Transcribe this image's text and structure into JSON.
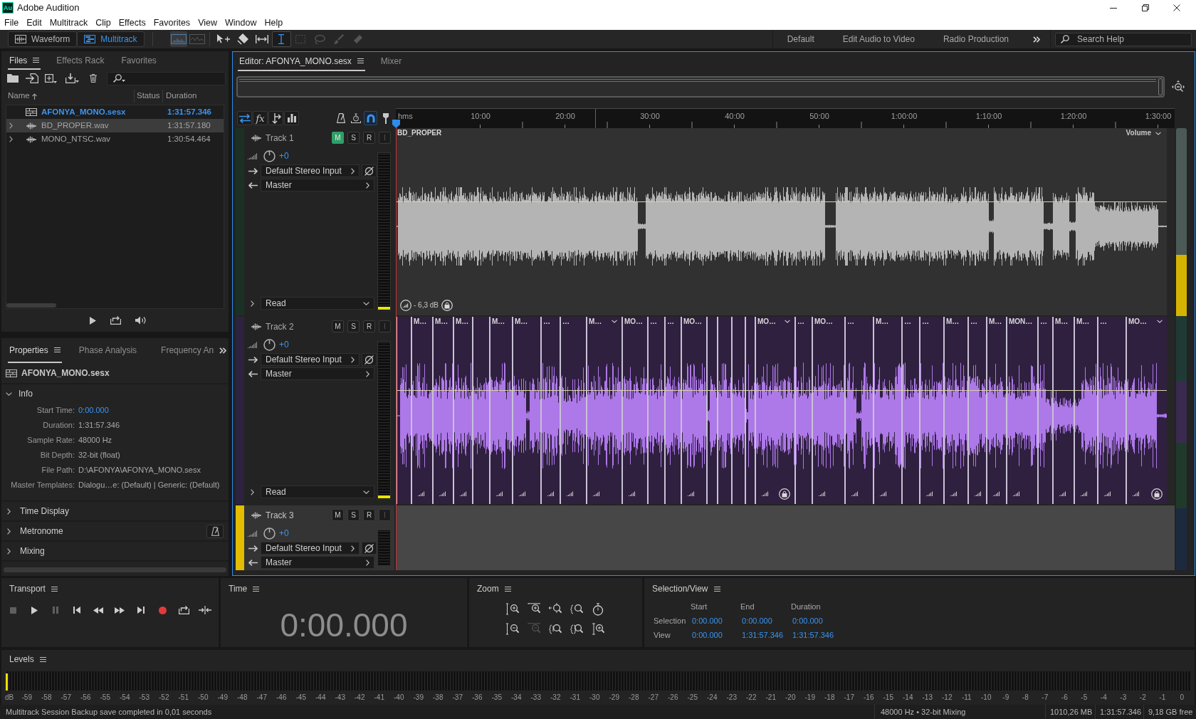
{
  "window": {
    "logo": "Au",
    "title": "Adobe Audition"
  },
  "menu": [
    "File",
    "Edit",
    "Multitrack",
    "Clip",
    "Effects",
    "Favorites",
    "View",
    "Window",
    "Help"
  ],
  "toolbar": {
    "views": [
      {
        "label": "Waveform",
        "selected": false
      },
      {
        "label": "Multitrack",
        "selected": true
      }
    ],
    "tools": [
      {
        "selected": true,
        "disabled": true
      },
      {
        "selected": false,
        "disabled": true
      },
      {
        "selected": false,
        "disabled": false
      },
      {
        "selected": false,
        "disabled": false
      },
      {
        "selected": false,
        "disabled": false
      },
      {
        "selected": true,
        "disabled": false
      },
      {
        "selected": false,
        "disabled": true
      },
      {
        "selected": false,
        "disabled": true
      },
      {
        "selected": false,
        "disabled": true
      },
      {
        "selected": false,
        "disabled": true
      }
    ],
    "workspaces": [
      "Default",
      "Edit Audio to Video",
      "Radio Production"
    ],
    "search": {
      "placeholder": "Search Help"
    }
  },
  "files_panel": {
    "tabs": [
      {
        "label": "Files",
        "selected": true
      },
      {
        "label": "Effects Rack",
        "selected": false
      },
      {
        "label": "Favorites",
        "selected": false
      }
    ],
    "columns": [
      "Name",
      "Status",
      "Duration"
    ],
    "rows": [
      {
        "kind": "session",
        "name": "AFONYA_MONO.sesx",
        "duration": "1:31:57.346",
        "open": true,
        "selected": false
      },
      {
        "kind": "audio",
        "name": "BD_PROPER.wav",
        "duration": "1:31:57.180",
        "open": false,
        "selected": true,
        "expanded": false
      },
      {
        "kind": "audio",
        "name": "MONO_NTSC.wav",
        "duration": "1:30:54.464",
        "open": false,
        "selected": false,
        "expanded": false
      }
    ]
  },
  "properties_panel": {
    "tabs": [
      {
        "label": "Properties",
        "selected": true
      },
      {
        "label": "Phase Analysis",
        "selected": false
      },
      {
        "label": "Frequency An",
        "selected": false
      }
    ],
    "file_name": "AFONYA_MONO.sesx",
    "sections": [
      {
        "title": "Info",
        "kind": "plain",
        "expanded": true,
        "rows": [
          {
            "label": "Start Time:",
            "value": "0:00.000",
            "editable": true
          },
          {
            "label": "Duration:",
            "value": "1:31:57.346",
            "editable": false
          },
          {
            "label": "Sample Rate:",
            "value": "48000 Hz",
            "editable": false
          },
          {
            "label": "Bit Depth:",
            "value": "32-bit (float)",
            "editable": false
          },
          {
            "label": "File Path:",
            "value": "D:\\AFONYA\\AFONYA_MONO.sesx",
            "editable": false
          },
          {
            "label": "Master Templates:",
            "value": "Dialogu…e: (Default) | Generic: (Default)",
            "editable": false
          }
        ]
      },
      {
        "title": "Time Display",
        "kind": "plain",
        "expanded": false
      },
      {
        "title": "Metronome",
        "kind": "button",
        "expanded": false
      },
      {
        "title": "Mixing",
        "kind": "plain",
        "expanded": false
      }
    ]
  },
  "editor": {
    "tabs": [
      {
        "label": "Editor: AFONYA_MONO.sesx",
        "selected": true
      },
      {
        "label": "Mixer",
        "selected": false
      }
    ],
    "view_buttons": [
      {
        "selected": true
      },
      {
        "label": "fx",
        "selected": false
      },
      {
        "selected": false
      },
      {
        "selected": false
      }
    ],
    "snap_buttons": [
      {
        "selected": false
      },
      {
        "selected": false
      },
      {
        "selected": true
      },
      {
        "selected": false
      }
    ],
    "ruler": {
      "unit": "hms",
      "labels": [
        "10:00",
        "20:00",
        "30:00",
        "40:00",
        "50:00",
        "1:00:00",
        "1:10:00",
        "1:20:00",
        "1:30:00"
      ]
    },
    "tracks": [
      {
        "name": "Track 1",
        "color": "#1c3126",
        "selected": false,
        "buttons": [
          {
            "label": "M",
            "on": true,
            "disabled": false
          },
          {
            "label": "S",
            "on": false,
            "disabled": false
          },
          {
            "label": "R",
            "on": false,
            "disabled": false
          },
          {
            "label": "I",
            "on": false,
            "disabled": true
          }
        ],
        "volume": "+0",
        "input": "Default Stereo Input",
        "output": "Master",
        "automation": "Read",
        "meter": {
          "level": 0.02
        },
        "clips": [
          {
            "label": "BD_PROPER",
            "color": "#b4b4b4",
            "envelope": "Volume",
            "gain": "- 6,3 dB",
            "locked": true
          }
        ]
      },
      {
        "name": "Track 2",
        "color": "#2d2340",
        "selected": false,
        "buttons": [
          {
            "label": "M",
            "on": false,
            "disabled": false
          },
          {
            "label": "S",
            "on": false,
            "disabled": false
          },
          {
            "label": "R",
            "on": false,
            "disabled": false
          },
          {
            "label": "I",
            "on": false,
            "disabled": true
          }
        ],
        "volume": "+0",
        "input": "Default Stereo Input",
        "output": "Master",
        "automation": "Read",
        "meter": {
          "level": 0.02
        },
        "clips": [
          {
            "color": "#ad78e8",
            "locked": false
          },
          {
            "label": "M…",
            "color": "#ad78e8",
            "locked": false
          },
          {
            "label": "M…",
            "color": "#ad78e8",
            "locked": false
          },
          {
            "label": "M…",
            "color": "#ad78e8",
            "locked": false
          },
          {
            "color": "#ad78e8",
            "locked": false
          },
          {
            "label": "M…",
            "color": "#ad78e8",
            "locked": false
          },
          {
            "label": "M…",
            "color": "#ad78e8",
            "locked": false
          },
          {
            "label": "…",
            "color": "#ad78e8",
            "locked": false
          },
          {
            "label": "…",
            "color": "#ad78e8",
            "locked": false
          },
          {
            "label": "M…",
            "color": "#ad78e8",
            "locked": false
          },
          {
            "label": "MO…",
            "color": "#ad78e8",
            "locked": false
          },
          {
            "label": "…",
            "color": "#ad78e8",
            "locked": false
          },
          {
            "label": "…",
            "color": "#ad78e8",
            "locked": false
          },
          {
            "label": "MO…",
            "color": "#ad78e8",
            "locked": false
          },
          {
            "color": "#ad78e8",
            "locked": false
          },
          {
            "color": "#ad78e8",
            "locked": false
          },
          {
            "color": "#ad78e8",
            "locked": false
          },
          {
            "color": "#ad78e8",
            "locked": false
          },
          {
            "label": "MO…",
            "color": "#ad78e8",
            "locked": true
          },
          {
            "label": "…",
            "color": "#ad78e8",
            "locked": false
          },
          {
            "label": "MO…",
            "color": "#ad78e8",
            "locked": false
          },
          {
            "label": "…",
            "color": "#ad78e8",
            "locked": false
          },
          {
            "label": "M…",
            "color": "#ad78e8",
            "locked": false
          },
          {
            "label": "…",
            "color": "#ad78e8",
            "locked": false
          },
          {
            "label": "…",
            "color": "#ad78e8",
            "locked": false
          },
          {
            "label": "M…",
            "color": "#ad78e8",
            "locked": false
          },
          {
            "label": "…",
            "color": "#ad78e8",
            "locked": false
          },
          {
            "label": "M…",
            "color": "#ad78e8",
            "locked": false
          },
          {
            "label": "MON…",
            "color": "#ad78e8",
            "locked": false
          },
          {
            "label": "…",
            "color": "#ad78e8",
            "locked": false
          },
          {
            "label": "M…",
            "color": "#ad78e8",
            "locked": false
          },
          {
            "label": "M…",
            "color": "#ad78e8",
            "locked": false
          },
          {
            "label": "…",
            "color": "#ad78e8",
            "locked": false
          },
          {
            "label": "MO…",
            "color": "#ad78e8",
            "locked": true
          }
        ]
      },
      {
        "name": "Track 3",
        "color": "#e2bd00",
        "selected": true,
        "buttons": [
          {
            "label": "M",
            "on": false,
            "disabled": false
          },
          {
            "label": "S",
            "on": false,
            "disabled": false
          },
          {
            "label": "R",
            "on": false,
            "disabled": false
          },
          {
            "label": "I",
            "on": false,
            "disabled": true
          }
        ],
        "volume": "+0",
        "input": "Default Stereo Input",
        "output": "Master"
      }
    ]
  },
  "transport": {
    "title": "Transport",
    "buttons": [
      {
        "disabled": true
      },
      {
        "disabled": false
      },
      {
        "disabled": true
      },
      {
        "disabled": false
      },
      {
        "disabled": false
      },
      {
        "disabled": false
      },
      {
        "disabled": false
      },
      {
        "disabled": false
      },
      {
        "disabled": false
      },
      {
        "disabled": false
      }
    ]
  },
  "time": {
    "title": "Time",
    "value": "0:00.000"
  },
  "zoom": {
    "title": "Zoom",
    "buttons": [
      {
        "disabled": false
      },
      {
        "disabled": false
      },
      {
        "disabled": false
      },
      {
        "disabled": false
      },
      {
        "disabled": false
      },
      {
        "disabled": false
      },
      {
        "disabled": true
      },
      {
        "disabled": false
      },
      {
        "disabled": false
      },
      {
        "disabled": false
      }
    ]
  },
  "selection_view": {
    "title": "Selection/View",
    "columns": [
      "Start",
      "End",
      "Duration"
    ],
    "rows": [
      {
        "label": "Selection",
        "values": [
          "0:00.000",
          "0:00.000",
          "0:00.000"
        ]
      },
      {
        "label": "View",
        "values": [
          "0:00.000",
          "1:31:57.346",
          "1:31:57.346"
        ]
      }
    ]
  },
  "levels": {
    "title": "Levels",
    "level": 0.002,
    "scale": [
      "dB",
      "-59",
      "-58",
      "-57",
      "-56",
      "-55",
      "-54",
      "-53",
      "-52",
      "-51",
      "-50",
      "-49",
      "-48",
      "-47",
      "-46",
      "-45",
      "-44",
      "-43",
      "-42",
      "-41",
      "-40",
      "-39",
      "-38",
      "-37",
      "-36",
      "-35",
      "-34",
      "-33",
      "-32",
      "-31",
      "-30",
      "-29",
      "-28",
      "-27",
      "-26",
      "-25",
      "-24",
      "-23",
      "-22",
      "-21",
      "-20",
      "-19",
      "-18",
      "-17",
      "-16",
      "-15",
      "-14",
      "-13",
      "-12",
      "-11",
      "-10",
      "-9",
      "-8",
      "-7",
      "-6",
      "-5",
      "-4",
      "-3",
      "-2",
      "-1",
      "0"
    ]
  },
  "status_bar": {
    "message": "Multitrack Session Backup save completed in 0,01 seconds",
    "items": [
      "48000 Hz • 32-bit Mixing",
      "1010,26 MB",
      "1:31:57.346",
      "9,18 GB free"
    ]
  }
}
